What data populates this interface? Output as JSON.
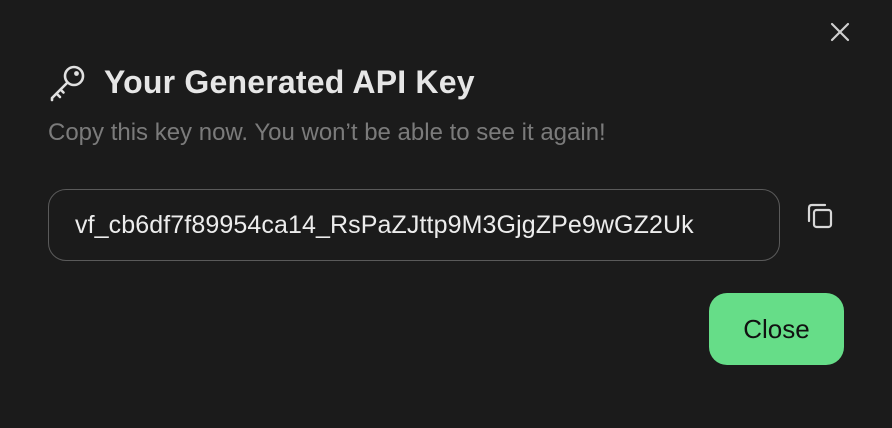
{
  "dialog": {
    "title": "Your Generated API Key",
    "subtitle": "Copy this key now. You won’t be able to see it again!",
    "api_key": "vf_cb6df7f89954ca14_RsPaZJttp9M3GjgZPe9wGZ2Uk",
    "close_label": "Close",
    "icons": {
      "title": "key-icon",
      "dismiss": "close-icon",
      "copy": "copy-icon"
    },
    "colors": {
      "background": "#1b1b1b",
      "accent": "#66dd88",
      "title_text": "#e6e6e6",
      "subtitle_text": "#7b7b7b",
      "field_border": "#5a5a5a"
    }
  }
}
